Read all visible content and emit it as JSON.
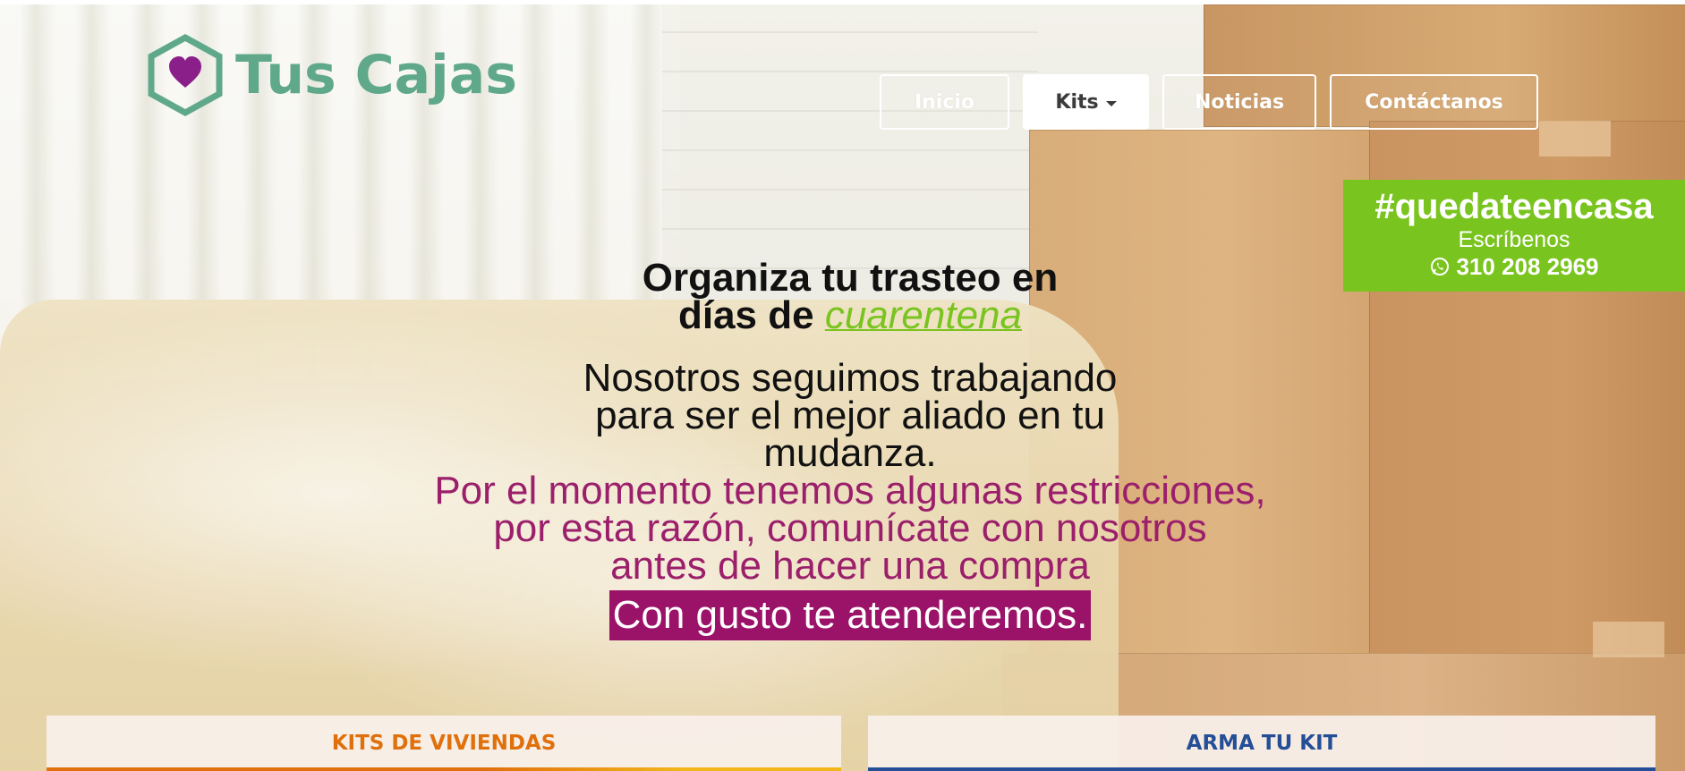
{
  "brand": {
    "name": "Tus Cajas",
    "color": "#5fa98a",
    "heart_color": "#8b1f8a"
  },
  "nav": {
    "items": [
      {
        "label": "Inicio"
      },
      {
        "label": "Kits"
      },
      {
        "label": "Noticias"
      },
      {
        "label": "Contáctanos"
      }
    ],
    "active_index": 1
  },
  "promo": {
    "hashtag": "#quedateencasa",
    "subtitle": "Escríbenos",
    "phone": "310 208 2969",
    "icon": "whatsapp-icon",
    "background": "#7ac41f"
  },
  "hero": {
    "headline_line1": "Organiza tu trasteo en",
    "headline_line2_prefix": "días de ",
    "headline_highlight": "cuarentena",
    "body_black": "Nosotros seguimos trabajando para ser el mejor aliado en tu mudanza.",
    "body_purple_1": "Por el momento tenemos algunas restricciones,",
    "body_purple_2": "por esta razón, comunícate con nosotros",
    "body_purple_3": "antes de hacer una compra",
    "cta": "Con gusto te atenderemos."
  },
  "tabs": [
    {
      "label": "KITS DE VIVIENDAS",
      "color": "#e0700c"
    },
    {
      "label": "ARMA TU KIT",
      "color": "#244f96"
    }
  ]
}
